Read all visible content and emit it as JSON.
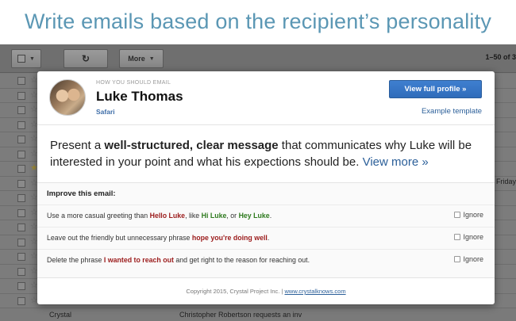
{
  "headline": "Write emails based on the recipient’s personality",
  "gmail": {
    "refresh_icon": "↻",
    "more_label": "More",
    "pager": "1–50 of 3",
    "friday": "Friday",
    "bottom_sender": "Crystal",
    "bottom_subject": "Christopher Robertson requests an inv"
  },
  "popup": {
    "how_label": "HOW YOU SHOULD EMAIL",
    "name": "Luke Thomas",
    "browser": "Safari",
    "view_profile": "View full profile »",
    "example_template": "Example template",
    "message": {
      "p1": "Present a ",
      "strong": "well-structured, clear message",
      "p2": " that communicates why Luke will be interested in your point and what his expections should be. ",
      "more": "View more »"
    },
    "improve_title": "Improve this email:",
    "suggestions": [
      {
        "pre": "Use a more casual greeting than ",
        "h1": "Hello Luke",
        "mid1": ", like ",
        "h2": "Hi Luke",
        "mid2": ", or ",
        "h3": "Hey Luke",
        "post": "."
      },
      {
        "pre": "Leave out the friendly but unnecessary phrase ",
        "h1": "hope you're doing well",
        "post": "."
      },
      {
        "pre": "Delete the phrase ",
        "h1": "I wanted to reach out",
        "post": " and get right to the reason for reaching out."
      }
    ],
    "ignore_label": "Ignore",
    "footer_text": "Copyright 2015, Crystal Project Inc. | ",
    "footer_link": "www.crystalknows.com"
  }
}
